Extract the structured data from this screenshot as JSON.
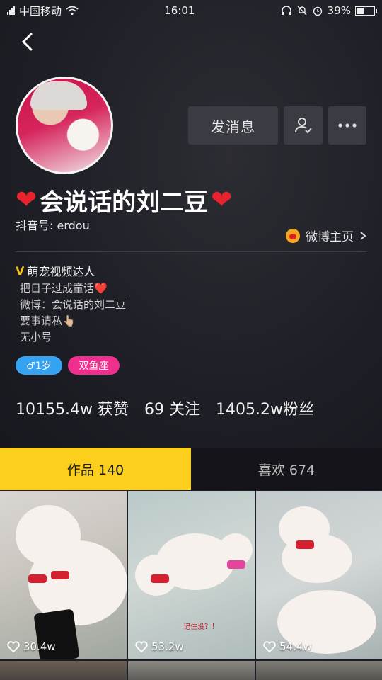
{
  "status_bar": {
    "carrier": "中国移动",
    "time": "16:01",
    "battery": "39%",
    "battery_level": 0.39
  },
  "profile": {
    "message_button": "发消息",
    "nickname": "会说话的刘二豆",
    "douyin_id": "抖音号: erdou",
    "weibo_link": "微博主页",
    "verification": "萌宠视频达人",
    "bio": [
      "把日子过成童话❤️",
      "微博：会说话的刘二豆",
      "要事请私👆🏼",
      "无小号"
    ],
    "tags": {
      "age": "♂1岁",
      "sign": "双鱼座"
    },
    "stats": {
      "likes": "10155.4w 获赞",
      "following": "69 关注",
      "followers": "1405.2w粉丝"
    }
  },
  "tabs": {
    "works": "作品 140",
    "liked": "喜欢 674"
  },
  "videos": [
    {
      "likes": "30.4w"
    },
    {
      "likes": "53.2w",
      "caption": "记住没？！"
    },
    {
      "likes": "54.4w"
    }
  ],
  "colors": {
    "accent_tab": "#fccf1d",
    "age_tag": "#35a2f2",
    "sign_tag": "#ee2f8d",
    "verify": "#f5c518",
    "heart": "#e8232d"
  }
}
